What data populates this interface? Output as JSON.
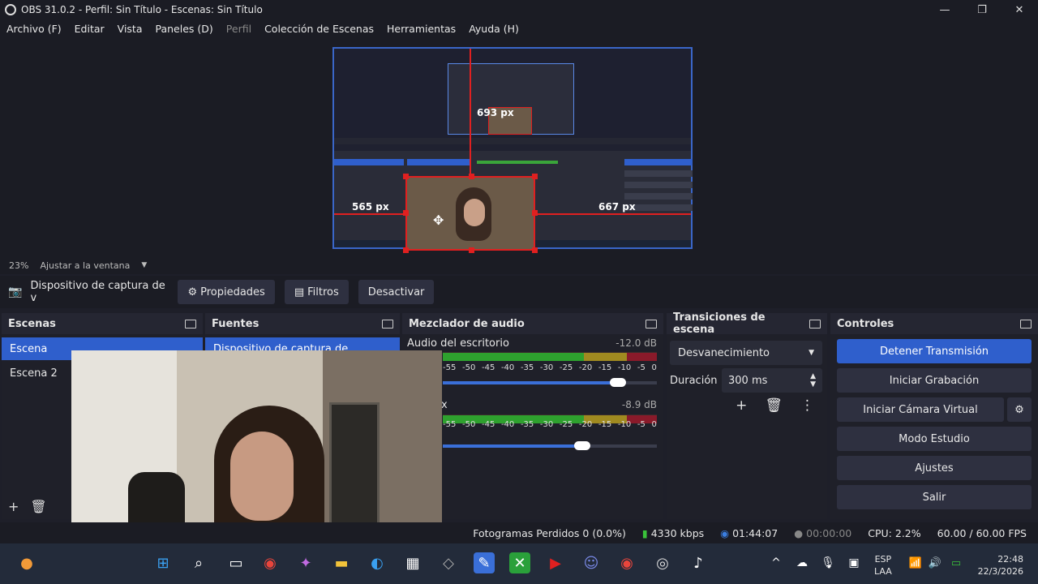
{
  "window": {
    "title": "OBS 31.0.2 - Perfil: Sin Título - Escenas: Sin Título",
    "minimize": "—",
    "maximize": "❐",
    "close": "✕"
  },
  "menu": [
    "Archivo (F)",
    "Editar",
    "Vista",
    "Paneles (D)",
    "Perfil",
    "Colección de Escenas",
    "Herramientas",
    "Ayuda (H)"
  ],
  "preview": {
    "label_left": "565 px",
    "label_right": "667 px",
    "label_top": "693 px"
  },
  "zoom": {
    "percent": "23%",
    "mode": "Ajustar a la ventana"
  },
  "source_toolbar": {
    "source_name": "Dispositivo de captura de v",
    "properties": "Propiedades",
    "filters": "Filtros",
    "deactivate": "Desactivar"
  },
  "scenes": {
    "title": "Escenas",
    "items": [
      "Escena",
      "Escena 2"
    ]
  },
  "sources": {
    "title": "Fuentes",
    "items": [
      "Dispositivo de captura de"
    ]
  },
  "mixer": {
    "title": "Mezclador de audio",
    "channels": [
      {
        "name": "Audio del escritorio",
        "db": "-12.0 dB",
        "level": 0.82
      },
      {
        "name": "x",
        "db": "-8.9 dB",
        "level": 0.65
      }
    ],
    "scale": [
      "-55",
      "-50",
      "-45",
      "-40",
      "-35",
      "-30",
      "-25",
      "-20",
      "-15",
      "-10",
      "-5",
      "0"
    ]
  },
  "transitions": {
    "title": "Transiciones de escena",
    "selected": "Desvanecimiento",
    "duration_label": "Duración",
    "duration": "300 ms"
  },
  "controls": {
    "title": "Controles",
    "stop_stream": "Detener Transmisión",
    "start_record": "Iniciar Grabación",
    "virtual_cam": "Iniciar Cámara Virtual",
    "studio_mode": "Modo Estudio",
    "settings": "Ajustes",
    "exit": "Salir"
  },
  "status": {
    "dropped": "Fotogramas Perdidos 0 (0.0%)",
    "bitrate": "4330 kbps",
    "stream_time": "01:44:07",
    "rec_time": "00:00:00",
    "cpu": "CPU: 2.2%",
    "fps": "60.00 / 60.00 FPS"
  },
  "taskbar": {
    "lang": "ESP",
    "lang2": "LAA",
    "time": "22:48",
    "date": "22/3/2026"
  },
  "colors": {
    "accent": "#2f5fcc",
    "selection": "#e02020",
    "bg": "#1e1f29"
  }
}
